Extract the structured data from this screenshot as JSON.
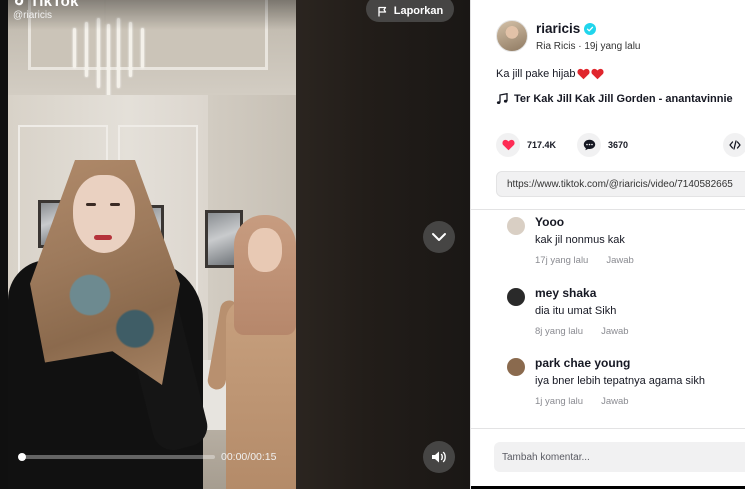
{
  "video": {
    "brand": "TikTok",
    "handle": "@riaricis",
    "report_label": "Laporkan",
    "time": "00:00/00:15",
    "progress_fraction": 0.02
  },
  "post": {
    "username": "riaricis",
    "display_name": "Ria Ricis",
    "posted_ago": "19j yang lalu",
    "caption": "Ka jill pake hijab",
    "music": "Ter Kak Jill Kak Jill Gorden - anantavinnie",
    "likes": "717.4K",
    "comments_count": "3670",
    "url": "https://www.tiktok.com/@riaricis/video/7140582665"
  },
  "comments": [
    {
      "name": "Yooo",
      "text": "kak jil nonmus kak",
      "ago": "17j yang lalu",
      "reply": "Jawab",
      "avatar_color": "#d9cfc4"
    },
    {
      "name": "mey shaka",
      "text": "dia itu umat Sikh",
      "ago": "8j yang lalu",
      "reply": "Jawab",
      "avatar_color": "#2a2a2a"
    },
    {
      "name": "park chae young",
      "text": "iya bner lebih tepatnya agama sikh",
      "ago": "1j yang lalu",
      "reply": "Jawab",
      "avatar_color": "#8a6a4e"
    }
  ],
  "comment_input": {
    "placeholder": "Tambah komentar..."
  },
  "colors": {
    "accent_verified": "#20d5ec",
    "like_red": "#fe2c55",
    "panel_bg": "#ffffff"
  },
  "icons": {
    "report": "flag-icon",
    "nav": "chevron-down-icon",
    "volume": "speaker-icon",
    "music": "music-note-icon",
    "like": "heart-icon",
    "comment": "comment-bubble-icon",
    "embed": "code-embed-icon"
  }
}
